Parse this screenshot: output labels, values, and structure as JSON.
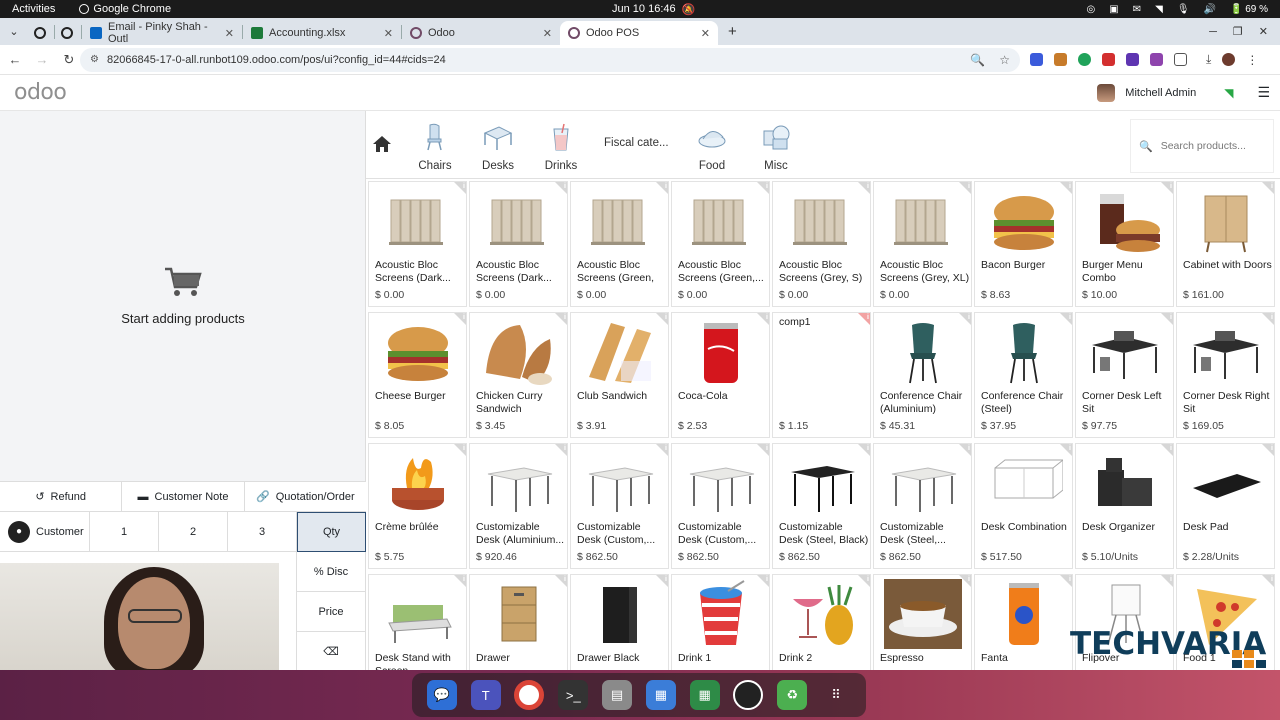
{
  "os": {
    "activities": "Activities",
    "app_name": "Google Chrome",
    "clock": "Jun 10  16:46",
    "battery": "69 %"
  },
  "browser": {
    "tabs": [
      {
        "label": "",
        "icon_color": "#222"
      },
      {
        "label": "",
        "icon_color": "#222"
      },
      {
        "label": "Email - Pinky Shah - Outl",
        "icon_color": "#0a66c2"
      },
      {
        "label": "Accounting.xlsx",
        "icon_color": "#1d7a3a"
      },
      {
        "label": "Odoo",
        "icon_color": "#714b67"
      },
      {
        "label": "Odoo POS",
        "icon_color": "#714b67"
      }
    ],
    "url": "82066845-17-0-all.runbot109.odoo.com/pos/ui?config_id=44#cids=24"
  },
  "header": {
    "logo": "odoo",
    "user": "Mitchell Admin"
  },
  "order": {
    "empty_text": "Start adding products"
  },
  "actions": {
    "refund": "Refund",
    "customer_note": "Customer Note",
    "quotation": "Quotation/Order"
  },
  "numpad": {
    "customer": "Customer",
    "keys": [
      "1",
      "2",
      "3"
    ],
    "qty": "Qty",
    "disc": "% Disc",
    "price": "Price",
    "backspace": "⌫"
  },
  "categories": {
    "items": [
      "Chairs",
      "Desks",
      "Drinks",
      "Fiscal cate...",
      "Food",
      "Misc"
    ]
  },
  "search": {
    "placeholder": "Search products..."
  },
  "products": [
    {
      "name": "Acoustic Bloc Screens (Dark...",
      "price": "$ 0.00"
    },
    {
      "name": "Acoustic Bloc Screens (Dark...",
      "price": "$ 0.00"
    },
    {
      "name": "Acoustic Bloc Screens (Green, S)",
      "price": "$ 0.00"
    },
    {
      "name": "Acoustic Bloc Screens (Green,...",
      "price": "$ 0.00"
    },
    {
      "name": "Acoustic Bloc Screens (Grey, S)",
      "price": "$ 0.00"
    },
    {
      "name": "Acoustic Bloc Screens (Grey, XL)",
      "price": "$ 0.00"
    },
    {
      "name": "Bacon Burger",
      "price": "$ 8.63"
    },
    {
      "name": "Burger Menu Combo",
      "price": "$ 10.00"
    },
    {
      "name": "Cabinet with Doors",
      "price": "$ 161.00"
    },
    {
      "name": "Cheese Burger",
      "price": "$ 8.05"
    },
    {
      "name": "Chicken Curry Sandwich",
      "price": "$ 3.45"
    },
    {
      "name": "Club Sandwich",
      "price": "$ 3.91"
    },
    {
      "name": "Coca-Cola",
      "price": "$ 2.53"
    },
    {
      "name": "comp1",
      "price": "$ 1.15"
    },
    {
      "name": "Conference Chair (Aluminium)",
      "price": "$ 45.31"
    },
    {
      "name": "Conference Chair (Steel)",
      "price": "$ 37.95"
    },
    {
      "name": "Corner Desk Left Sit",
      "price": "$ 97.75"
    },
    {
      "name": "Corner Desk Right Sit",
      "price": "$ 169.05"
    },
    {
      "name": "Crème brûlée",
      "price": "$ 5.75"
    },
    {
      "name": "Customizable Desk (Aluminium...",
      "price": "$ 920.46"
    },
    {
      "name": "Customizable Desk (Custom,...",
      "price": "$ 862.50"
    },
    {
      "name": "Customizable Desk (Custom,...",
      "price": "$ 862.50"
    },
    {
      "name": "Customizable Desk (Steel, Black)",
      "price": "$ 862.50"
    },
    {
      "name": "Customizable Desk (Steel,...",
      "price": "$ 862.50"
    },
    {
      "name": "Desk Combination",
      "price": "$ 517.50"
    },
    {
      "name": "Desk Organizer",
      "price": "$ 5.10/Units"
    },
    {
      "name": "Desk Pad",
      "price": "$ 2.28/Units"
    },
    {
      "name": "Desk Stand with Screen",
      "price": ""
    },
    {
      "name": "Drawer",
      "price": ""
    },
    {
      "name": "Drawer Black",
      "price": ""
    },
    {
      "name": "Drink 1",
      "price": ""
    },
    {
      "name": "Drink 2",
      "price": ""
    },
    {
      "name": "Espresso",
      "price": ""
    },
    {
      "name": "Fanta",
      "price": ""
    },
    {
      "name": "Flipover",
      "price": ""
    },
    {
      "name": "Food 1",
      "price": ""
    }
  ],
  "watermark": "TECHVARIA"
}
